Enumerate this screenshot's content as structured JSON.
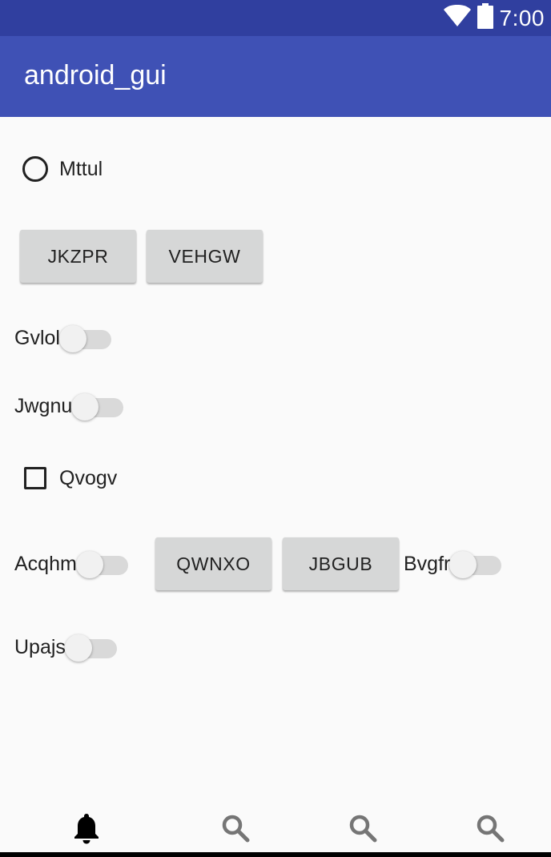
{
  "status_bar": {
    "time": "7:00",
    "icons": [
      "wifi-icon",
      "battery-icon"
    ]
  },
  "app_bar": {
    "title": "android_gui"
  },
  "radio": {
    "label": "Mttul",
    "checked": false
  },
  "buttons_row1": [
    "JKZPR",
    "VEHGW"
  ],
  "switches": {
    "gvlol": {
      "label": "Gvlol",
      "on": false
    },
    "jwgnu": {
      "label": "Jwgnu",
      "on": false
    },
    "acqhm": {
      "label": "Acqhm",
      "on": false
    },
    "bvgfr": {
      "label": "Bvgfr",
      "on": false
    },
    "upajs": {
      "label": "Upajs",
      "on": false
    }
  },
  "checkbox": {
    "label": "Qvogv",
    "checked": false
  },
  "buttons_row2": [
    "QWNXO",
    "JBGUB"
  ],
  "bottom_nav": {
    "items": [
      {
        "icon": "bell-icon",
        "selected": true
      },
      {
        "icon": "search-icon",
        "selected": false
      },
      {
        "icon": "search-icon",
        "selected": false
      },
      {
        "icon": "search-icon",
        "selected": false
      }
    ]
  },
  "colors": {
    "status_bar": "#303f9f",
    "app_bar": "#3f51b5",
    "background": "#fafafa",
    "button": "#d6d7d7",
    "text": "#212121",
    "icon_inactive": "#757575"
  }
}
